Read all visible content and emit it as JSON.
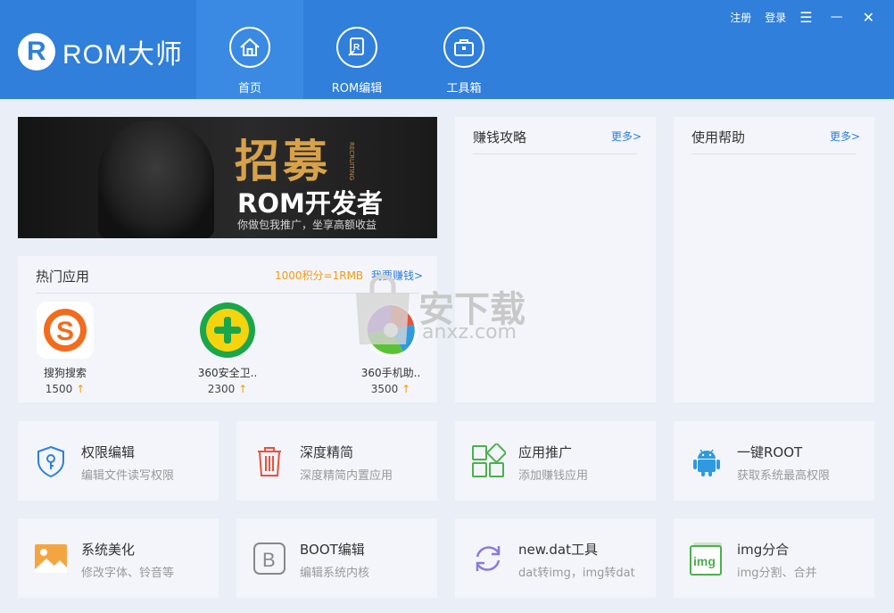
{
  "app": {
    "logo_letter": "R",
    "title": "ROM大师"
  },
  "nav": [
    {
      "label": "首页",
      "icon": "home-icon"
    },
    {
      "label": "ROM编辑",
      "icon": "rom-edit-icon"
    },
    {
      "label": "工具箱",
      "icon": "toolbox-icon"
    }
  ],
  "topbar": {
    "register": "注册",
    "login": "登录",
    "menu_icon": "☰",
    "minimize_icon": "—",
    "close_icon": "✕"
  },
  "banner": {
    "line1": "招募",
    "line2": "ROM开发者",
    "line3": "你做包我推广，坐享高额收益",
    "vertical": "RECRUITING"
  },
  "panels": {
    "earn": {
      "title": "赚钱攻略",
      "more": "更多>"
    },
    "help": {
      "title": "使用帮助",
      "more": "更多>"
    }
  },
  "hot_apps": {
    "title": "热门应用",
    "rate": "1000积分=1RMB",
    "earn_link": "我要赚钱>",
    "items": [
      {
        "name": "搜狗搜索",
        "points": "1500",
        "arrow": "↑"
      },
      {
        "name": "360安全卫..",
        "points": "2300",
        "arrow": "↑"
      },
      {
        "name": "360手机助..",
        "points": "3500",
        "arrow": "↑"
      }
    ]
  },
  "tools": [
    {
      "title": "权限编辑",
      "sub": "编辑文件读写权限",
      "icon": "shield-key-icon"
    },
    {
      "title": "深度精简",
      "sub": "深度精简内置应用",
      "icon": "trash-icon"
    },
    {
      "title": "应用推广",
      "sub": "添加赚钱应用",
      "icon": "apps-grid-icon"
    },
    {
      "title": "一键ROOT",
      "sub": "获取系统最高权限",
      "icon": "android-icon"
    },
    {
      "title": "系统美化",
      "sub": "修改字体、铃音等",
      "icon": "image-icon"
    },
    {
      "title": "BOOT编辑",
      "sub": "编辑系统内核",
      "icon": "boot-b-icon"
    },
    {
      "title": "new.dat工具",
      "sub": "dat转img，img转dat",
      "icon": "convert-icon"
    },
    {
      "title": "img分合",
      "sub": "img分割、合并",
      "icon": "img-file-icon"
    }
  ],
  "boot_letter": "B",
  "img_letter": "img",
  "watermark": {
    "text": "安下载",
    "url": "anxz.com"
  },
  "colors": {
    "primary": "#2f7fdb",
    "orange": "#f39c12",
    "green": "#4caf50",
    "red": "#e5533d"
  }
}
